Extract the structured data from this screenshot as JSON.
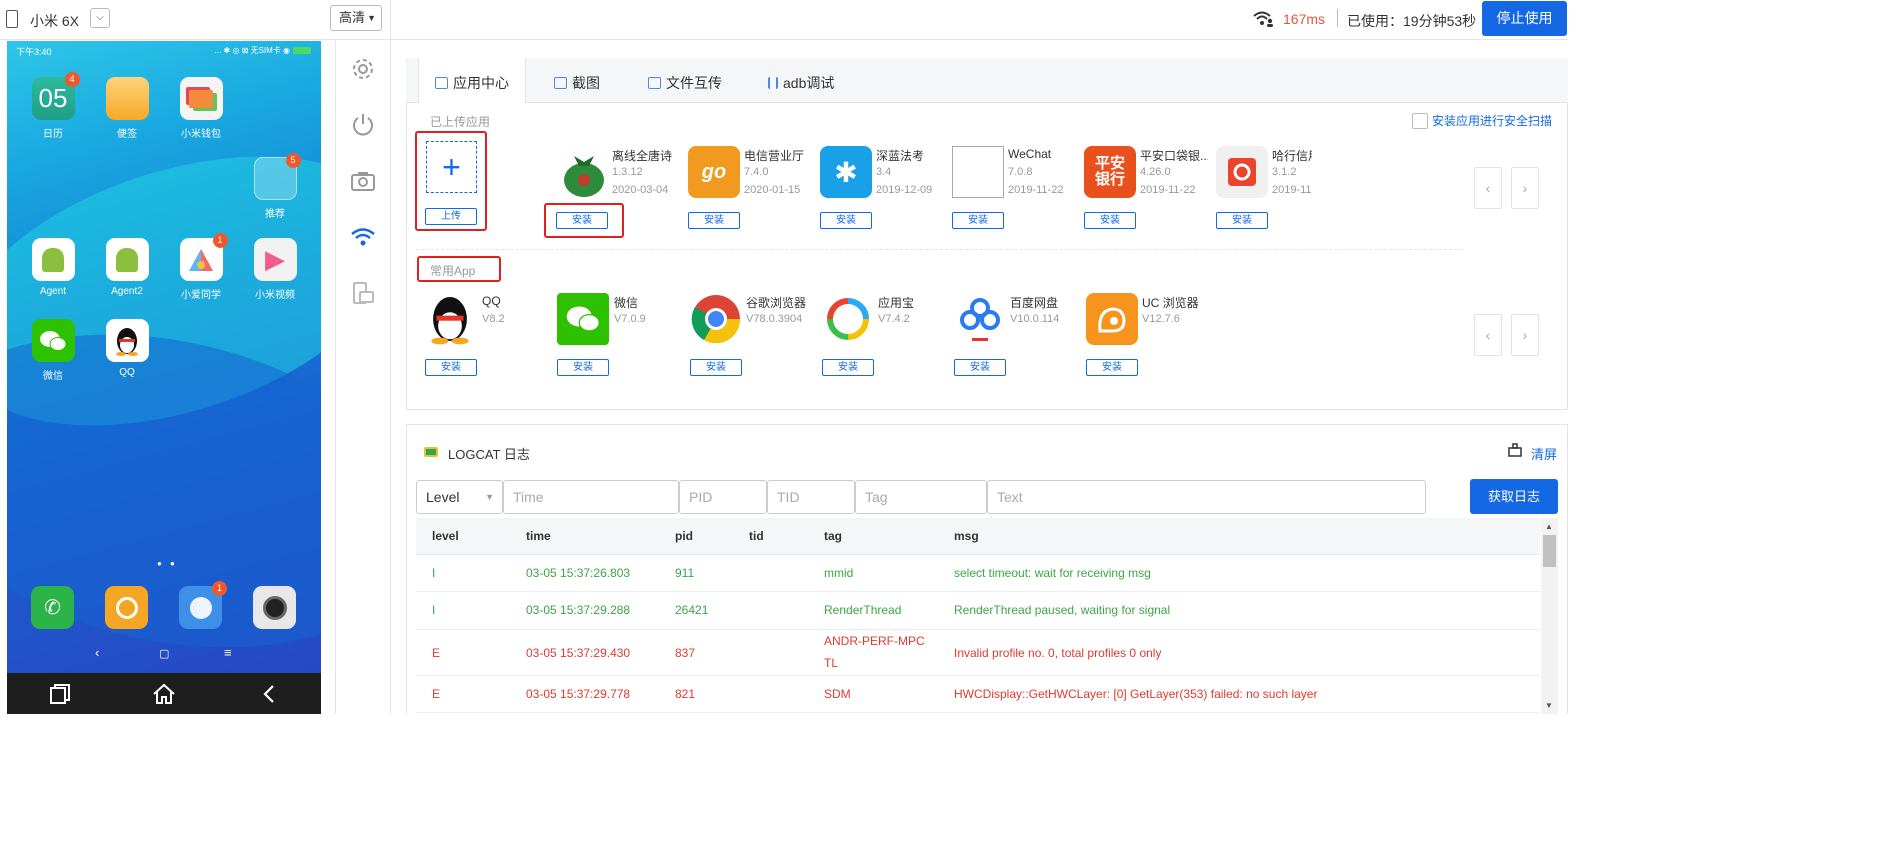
{
  "topbar": {
    "device_name": "小米 6X",
    "quality": "高清",
    "latency": "167ms",
    "used_time": "已使用：19分钟53秒",
    "stop_label": "停止使用"
  },
  "phone": {
    "time": "下午3:40",
    "status_right": "... ✱ ◎ ⊠ 无SIM卡 ◉",
    "apps": [
      {
        "label": "日历",
        "badge": "4",
        "glyph": "05"
      },
      {
        "label": "便签",
        "badge": "",
        "glyph": ""
      },
      {
        "label": "小米钱包",
        "badge": "",
        "glyph": ""
      },
      {
        "label": "推荐",
        "badge": "5",
        "glyph": ""
      },
      {
        "label": "Agent",
        "badge": "",
        "glyph": ""
      },
      {
        "label": "Agent2",
        "badge": "",
        "glyph": ""
      },
      {
        "label": "小爱同学",
        "badge": "1",
        "glyph": ""
      },
      {
        "label": "小米视频",
        "badge": "",
        "glyph": "▶"
      },
      {
        "label": "微信",
        "badge": "",
        "glyph": ""
      },
      {
        "label": "QQ",
        "badge": "",
        "glyph": ""
      }
    ],
    "dock_badge": "1",
    "nav_back": "‹",
    "nav_home": "▢",
    "nav_menu": "≡"
  },
  "app_center": {
    "tabs": [
      "应用中心",
      "截图",
      "文件互传",
      "adb调试"
    ],
    "uploaded_title": "已上传应用",
    "scan_label": "安装应用进行安全扫描",
    "upload_label": "上传",
    "install_label": "安装",
    "uploaded_apps": [
      {
        "name": "离线全唐诗",
        "version": "1.3.12",
        "date": "2020-03-04",
        "color": "#2e8b3a",
        "icon": "bag-icon"
      },
      {
        "name": "电信营业厅",
        "version": "7.4.0",
        "date": "2020-01-15",
        "color": "#f29a1f",
        "icon": "go-icon",
        "glyph": "go"
      },
      {
        "name": "深蓝法考",
        "version": "3.4",
        "date": "2019-12-09",
        "color": "#1aa0e6",
        "icon": "star-icon",
        "glyph": "✱"
      },
      {
        "name": "WeChat",
        "version": "7.0.8",
        "date": "2019-11-22",
        "color": "#ffffff",
        "icon": "broken-image-icon"
      },
      {
        "name": "平安口袋银...",
        "version": "4.26.0",
        "date": "2019-11-22",
        "color": "#e8501e",
        "icon": "pingan-icon",
        "glyph": "平安银行"
      },
      {
        "name": "哈行信用",
        "version": "3.1.2",
        "date": "2019-11",
        "color": "#f0f0f0",
        "icon": "hx-icon"
      }
    ],
    "common_title": "常用App",
    "common_apps": [
      {
        "name": "QQ",
        "version": "V8.2",
        "color": "#ffffff",
        "icon": "qq-icon"
      },
      {
        "name": "微信",
        "version": "V7.0.9",
        "color": "#2dc100",
        "icon": "wechat-icon"
      },
      {
        "name": "谷歌浏览器",
        "version": "V78.0.3904",
        "color": "#ffffff",
        "icon": "chrome-icon"
      },
      {
        "name": "应用宝",
        "version": "V7.4.2",
        "color": "#ffffff",
        "icon": "yyb-icon"
      },
      {
        "name": "百度网盘",
        "version": "V10.0.114",
        "color": "#ffffff",
        "icon": "baidu-pan-icon"
      },
      {
        "name": "UC 浏览器",
        "version": "V12.7.6",
        "color": "#f7941d",
        "icon": "uc-icon"
      }
    ],
    "nav_prev": "‹",
    "nav_next": "›"
  },
  "logcat": {
    "title": "LOGCAT 日志",
    "clear_label": "清屏",
    "filters": {
      "level": "Level",
      "time": "Time",
      "pid": "PID",
      "tid": "TID",
      "tag": "Tag",
      "text": "Text"
    },
    "get_label": "获取日志",
    "columns": [
      "level",
      "time",
      "pid",
      "tid",
      "tag",
      "msg"
    ],
    "rows": [
      {
        "level": "I",
        "time": "03-05 15:37:26.803",
        "pid": "911",
        "tid": "",
        "tag": "mmid",
        "msg": "select timeout: wait for receiving msg",
        "kind": "info"
      },
      {
        "level": "I",
        "time": "03-05 15:37:29.288",
        "pid": "26421",
        "tid": "",
        "tag": "RenderThread",
        "msg": "RenderThread paused, waiting for signal",
        "kind": "info"
      },
      {
        "level": "E",
        "time": "03-05 15:37:29.430",
        "pid": "837",
        "tid": "",
        "tag": "ANDR-PERF-MPCTL",
        "tag_line1": "ANDR-PERF-MPC",
        "tag_line2": "TL",
        "msg": "Invalid profile no. 0, total profiles 0 only",
        "kind": "err"
      },
      {
        "level": "E",
        "time": "03-05 15:37:29.778",
        "pid": "821",
        "tid": "",
        "tag": "SDM",
        "msg": "HWCDisplay::GetHWCLayer: [0] GetLayer(353) failed: no such layer",
        "kind": "err"
      }
    ]
  }
}
